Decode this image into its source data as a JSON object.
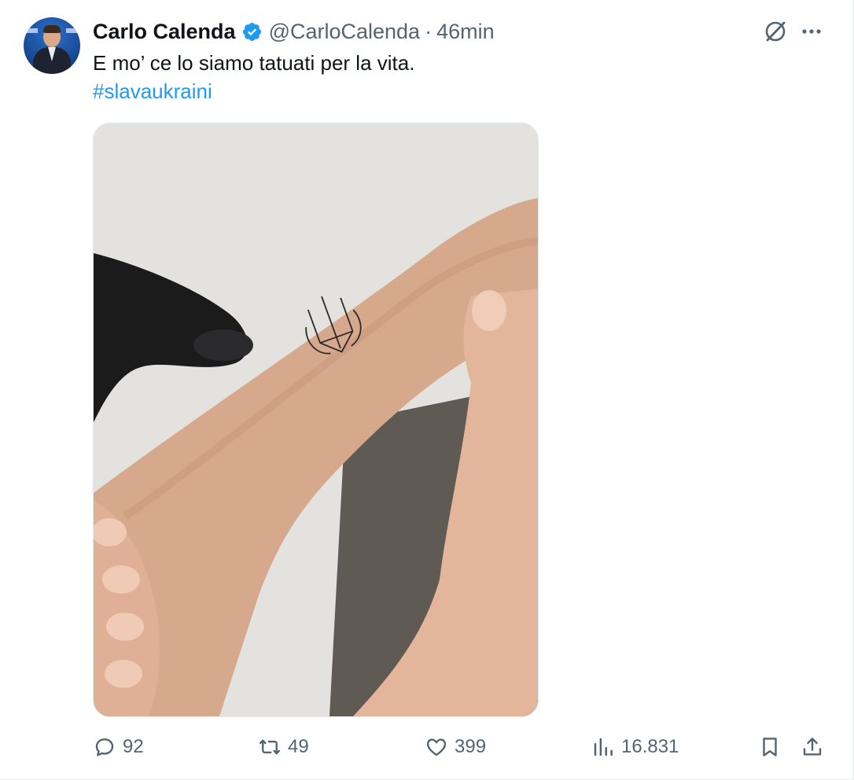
{
  "post": {
    "author": {
      "name": "Carlo Calenda",
      "handle": "@CarloCalenda",
      "verified": true
    },
    "separator": "·",
    "time": "46min",
    "text": "E mo’ ce lo siamo tatuati per la vita.",
    "hashtag": "#slavaukraini",
    "media_alt": "Photo of a forearm with a small line-art tattoo of the Ukrainian trident, held by a gloved hand"
  },
  "actions": {
    "replies": "92",
    "reposts": "49",
    "likes": "399",
    "views": "16.831"
  },
  "icons": {
    "reply": "reply-icon",
    "repost": "repost-icon",
    "like": "heart-icon",
    "views": "views-chart-icon",
    "bookmark": "bookmark-icon",
    "share": "share-icon",
    "grok": "grok-icon",
    "more": "more-icon",
    "verified": "verified-badge-icon"
  },
  "colors": {
    "text": "#0f1419",
    "secondary": "#536471",
    "link": "#1d9bf0",
    "verified": "#1d9bf0"
  }
}
